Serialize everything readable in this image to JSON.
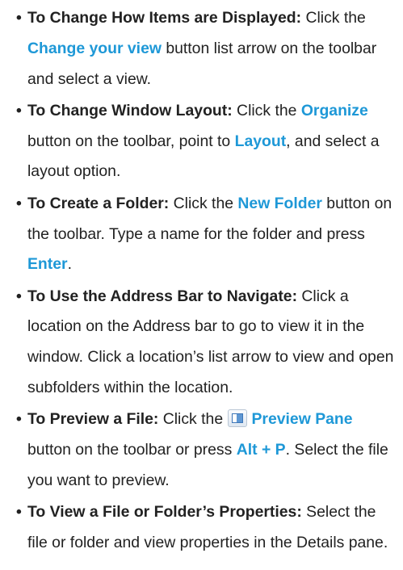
{
  "bullet": "•",
  "items": [
    {
      "lead": "To Change How Items are Displayed:",
      "t1": " Click the ",
      "k1": "Change your view",
      "t2": " button list arrow on the toolbar and select a view."
    },
    {
      "lead": "To Change Window Layout:",
      "t1": " Click the ",
      "k1": "Organize",
      "t2": " button on the toolbar, point to ",
      "k2": "Layout",
      "t3": ", and select a layout option."
    },
    {
      "lead": "To Create a Folder:",
      "t1": " Click the ",
      "k1": "New Folder",
      "t2": " button on the toolbar. Type a name for the folder and press ",
      "k2": "Enter",
      "t3": "."
    },
    {
      "lead": "To Use the Address Bar to Navigate:",
      "t1": " Click a location on the Address bar to go to view it in the window. Click a location’s list arrow to view and open subfolders within the location."
    },
    {
      "lead": "To Preview a File:",
      "t1": " Click the ",
      "icon": "preview-pane-icon",
      "k1": "Preview Pane",
      "t2": " button on the toolbar or press ",
      "k2": "Alt + P",
      "t3": ". Select the file you want to preview."
    },
    {
      "lead": "To View a File or Folder’s Properties:",
      "t1": " Select the file or folder and view properties in the Details pane."
    }
  ],
  "colors": {
    "keyword": "#1e98d7",
    "text": "#222222"
  }
}
